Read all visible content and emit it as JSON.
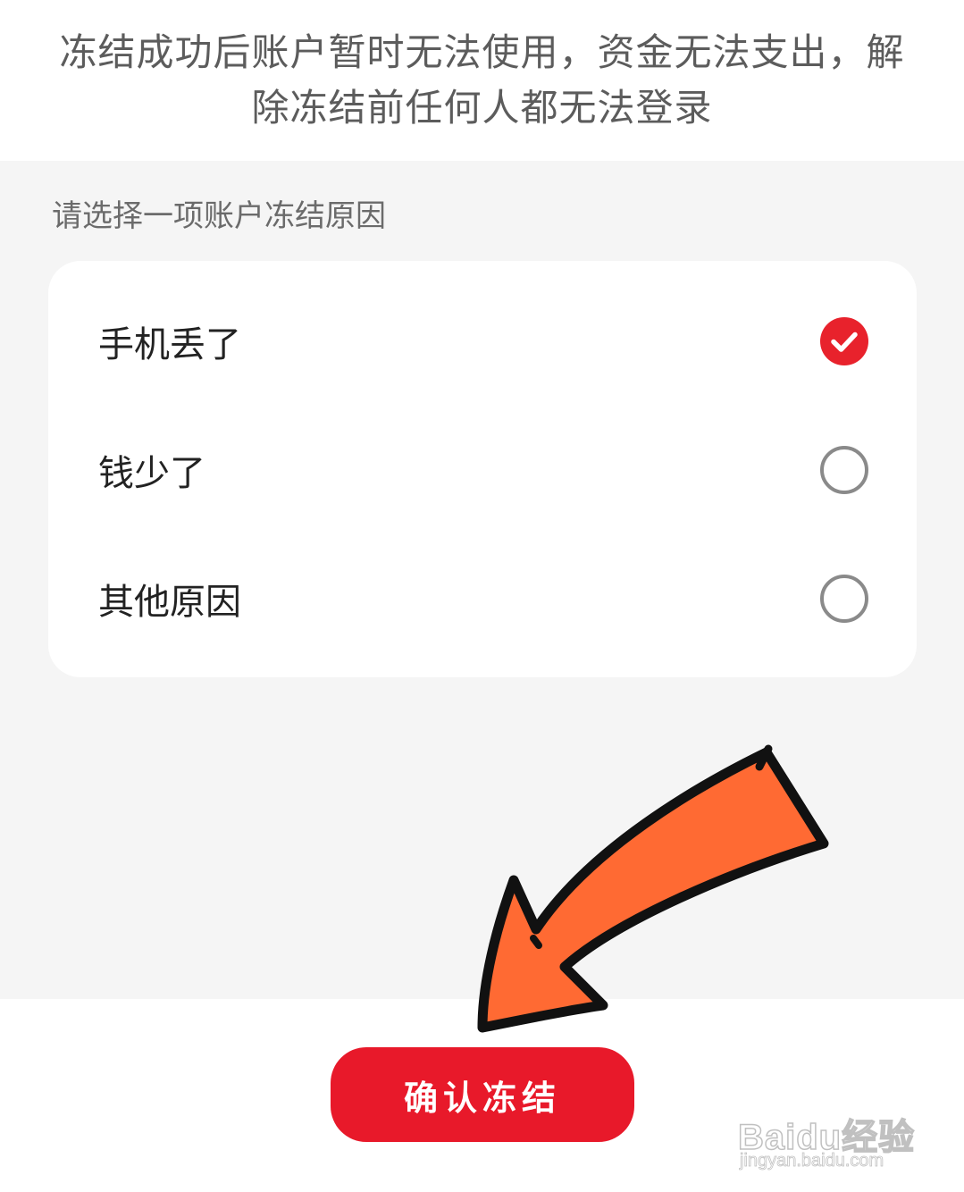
{
  "notice": {
    "text": "冻结成功后账户暂时无法使用，资金无法支出，解除冻结前任何人都无法登录"
  },
  "reasons": {
    "title": "请选择一项账户冻结原因",
    "options": [
      {
        "label": "手机丢了",
        "selected": true
      },
      {
        "label": "钱少了",
        "selected": false
      },
      {
        "label": "其他原因",
        "selected": false
      }
    ]
  },
  "footer": {
    "confirm_label": "确认冻结"
  },
  "watermark": {
    "logo": "Baidu经验",
    "url": "jingyan.baidu.com"
  },
  "colors": {
    "accent": "#e8192a",
    "arrow_fill": "#ff6a33",
    "gray_bg": "#f5f5f5"
  },
  "icons": {
    "checked": "check-circle-icon",
    "unchecked": "empty-circle-icon"
  }
}
